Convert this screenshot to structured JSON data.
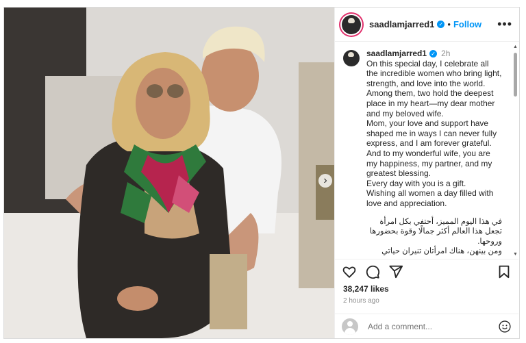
{
  "post": {
    "username": "saadlamjarred1",
    "follow_label": "Follow",
    "dot": "•",
    "more": "•••",
    "caption": {
      "username": "saadlamjarred1",
      "time": "2h",
      "text": "On this special day, I celebrate all the incredible women who bring light, strength, and love into the world.\nAmong them, two hold the deepest place in my heart—my dear mother and my beloved wife.\nMom, your love and support have shaped me in ways I can never fully express, and I am forever grateful.\nAnd to my wonderful wife, you are my happiness, my partner, and my greatest blessing.\nEvery day with you is a gift.\nWishing all women a day filled with love and appreciation.",
      "arabic": "في هذا اليوم المميز، أحتفي بكل امرأة تجعل هذا العالم أكثر جمالًا وقوة بحضورها وروحها.\nومن بينهن، هناك امرأتان تنيران حياتي بحب"
    },
    "likes": "38,247 likes",
    "posted_ago": "2 hours ago",
    "comment_placeholder": "Add a comment..."
  },
  "icons": {
    "verified": "✓",
    "next": "›",
    "scroll_up": "▲",
    "scroll_down": "▼"
  },
  "colors": {
    "accent": "#0095f6",
    "text": "#262626",
    "muted": "#8e8e8e"
  }
}
